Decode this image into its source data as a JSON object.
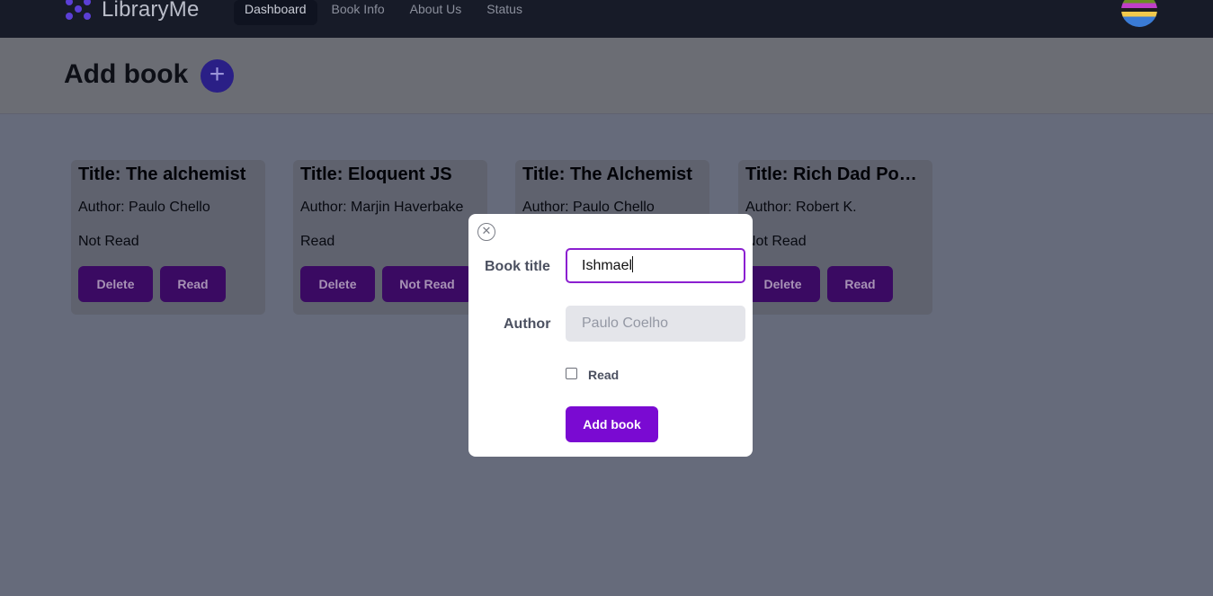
{
  "nav": {
    "brand": "LibraryMe",
    "links": [
      "Dashboard",
      "Book Info",
      "About Us",
      "Status"
    ],
    "active_link": "Dashboard"
  },
  "header": {
    "title": "Add book",
    "add_icon": "plus-icon"
  },
  "books": [
    {
      "title": "Title: The alchemist",
      "author": "Author: Paulo Chello",
      "status": "Not Read",
      "delete_label": "Delete",
      "toggle_label": "Read"
    },
    {
      "title": "Title: Eloquent JS",
      "author": "Author: Marjin Haverbake",
      "status": "Read",
      "delete_label": "Delete",
      "toggle_label": "Not Read"
    },
    {
      "title": "Title: The Alchemist",
      "author": "Author: Paulo Chello",
      "status": "",
      "delete_label": "",
      "toggle_label": ""
    },
    {
      "title": "Title: Rich Dad Poor…",
      "author": "Author: Robert K.",
      "status": "Not Read",
      "delete_label": "Delete",
      "toggle_label": "Read"
    }
  ],
  "modal": {
    "close_icon": "close-circle-icon",
    "title_label": "Book title",
    "title_value": "Ishmael",
    "author_label": "Author",
    "author_placeholder": "Paulo Coelho",
    "read_label": "Read",
    "read_checked": false,
    "submit_label": "Add book"
  },
  "colors": {
    "nav_bg": "#171b28",
    "accent_purple": "#7a0ad2",
    "overlay_bg": "#666b7b"
  }
}
